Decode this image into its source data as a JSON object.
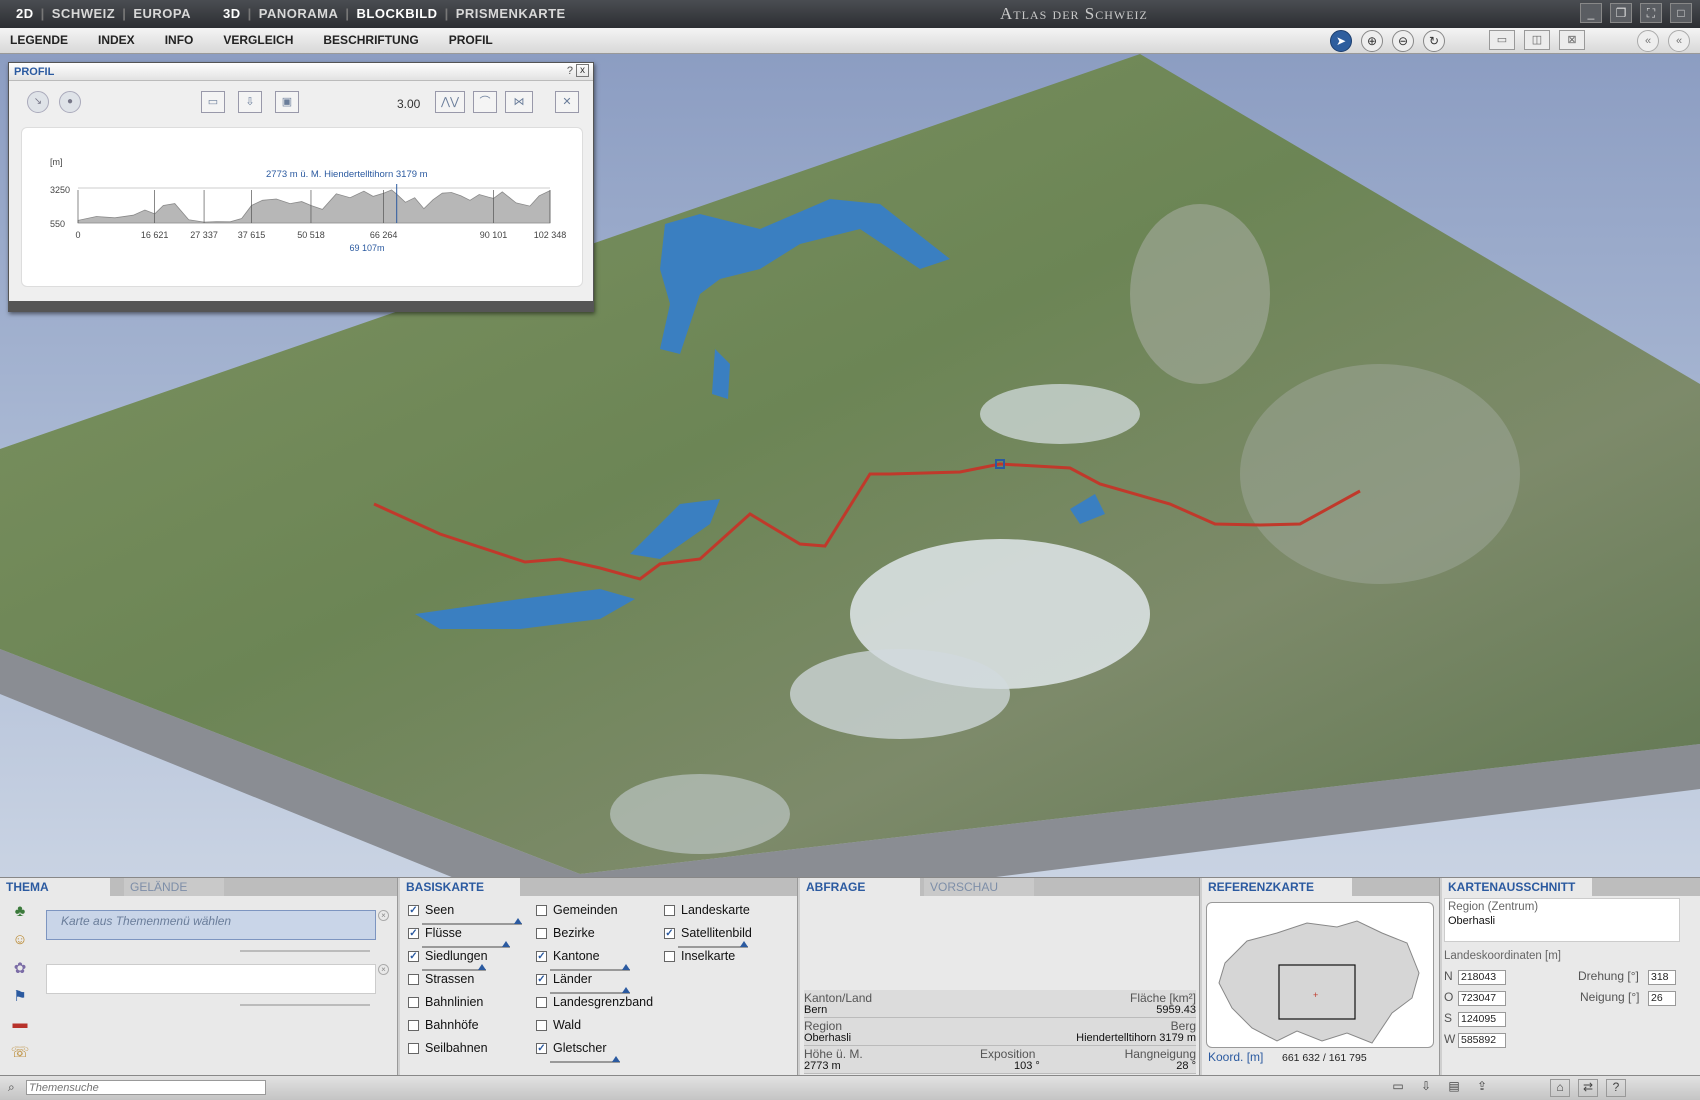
{
  "titlebar": {
    "modes": [
      "2D",
      "SCHWEIZ",
      "EUROPA",
      "3D",
      "PANORAMA",
      "BLOCKBILD",
      "PRISMENKARTE"
    ],
    "app_title": "Atlas der Schweiz",
    "window_buttons": [
      "minimize-icon",
      "restore-icon",
      "fullscreen-icon",
      "close-icon"
    ]
  },
  "menubar": {
    "items": [
      "LEGENDE",
      "INDEX",
      "INFO",
      "VERGLEICH",
      "BESCHRIFTUNG",
      "PROFIL"
    ],
    "tools": [
      "pointer-icon",
      "zoom-in-icon",
      "zoom-out-icon",
      "rotate-icon"
    ],
    "layout_tools": [
      "split-horizontal-icon",
      "split-vertical-icon",
      "diagonal-icon"
    ],
    "nav": [
      "collapse-icon",
      "back-icon"
    ]
  },
  "colors": {
    "accent": "#2b5aa0",
    "route": "#c0392b",
    "lake": "#3a7fc1",
    "terrain": "#6f8a52",
    "snow": "#e6eef2"
  },
  "profil": {
    "title": "PROFIL",
    "help": "?",
    "close": "x",
    "exaggeration": "3.00",
    "unit": "[m]",
    "y_top": "3250",
    "y_bottom": "550",
    "marker_label": "2773 m ü. M.  Hiendertelltihorn   3179 m",
    "cursor_distance": "69 107m",
    "x_ticks": [
      "0",
      "16 621",
      "27 337",
      "37 615",
      "50 518",
      "66 264",
      "90 101",
      "102 348"
    ],
    "chart_data": {
      "type": "area",
      "xlabel": "",
      "ylabel": "[m]",
      "ylim": [
        550,
        3250
      ],
      "xlim": [
        0,
        102348
      ],
      "x": [
        0,
        4000,
        8000,
        12000,
        14500,
        16621,
        18500,
        21000,
        24000,
        27337,
        30000,
        33000,
        35500,
        37615,
        40000,
        43000,
        46000,
        48500,
        50518,
        53000,
        56000,
        59000,
        62000,
        64000,
        66264,
        68000,
        69107,
        71000,
        73000,
        75000,
        77000,
        79000,
        81000,
        83000,
        85000,
        87000,
        89000,
        90101,
        92000,
        95000,
        98000,
        100000,
        102348
      ],
      "series": [
        {
          "name": "",
          "values": [
            750,
            1050,
            950,
            1150,
            1550,
            1250,
            1900,
            2050,
            800,
            620,
            650,
            640,
            900,
            1900,
            2300,
            2400,
            2050,
            2200,
            1900,
            1600,
            2800,
            2500,
            3000,
            2600,
            2850,
            3100,
            2773,
            2150,
            2500,
            1650,
            2350,
            2850,
            2900,
            2650,
            2300,
            2750,
            2550,
            2450,
            2950,
            2100,
            1850,
            2650,
            3050
          ]
        }
      ]
    },
    "toolbar": [
      "route-icon",
      "stop-icon",
      "folder-icon",
      "download-icon",
      "image-icon",
      "scale-icon",
      "curve-icon",
      "settings-icon",
      "clear-icon"
    ]
  },
  "thema": {
    "tab_active": "THEMA",
    "tab_inactive": "GELÄNDE",
    "placeholder": "Karte aus Themenmenü wählen",
    "second_field": "",
    "icons": [
      "forest-icon",
      "people-icon",
      "economy-icon",
      "flag-icon",
      "train-icon",
      "phone-icon"
    ],
    "search_placeholder": "Themensuche"
  },
  "basiskarte": {
    "title": "BASISKARTE",
    "col1": [
      {
        "label": "Seen",
        "checked": true
      },
      {
        "label": "Flüsse",
        "checked": true
      },
      {
        "label": "Siedlungen",
        "checked": true
      },
      {
        "label": "Strassen",
        "checked": false
      },
      {
        "label": "Bahnlinien",
        "checked": false
      },
      {
        "label": "Bahnhöfe",
        "checked": false
      },
      {
        "label": "Seilbahnen",
        "checked": false
      }
    ],
    "col2": [
      {
        "label": "Gemeinden",
        "checked": false
      },
      {
        "label": "Bezirke",
        "checked": false
      },
      {
        "label": "Kantone",
        "checked": true
      },
      {
        "label": "Länder",
        "checked": true
      },
      {
        "label": "Landesgrenzband",
        "checked": false
      },
      {
        "label": "Wald",
        "checked": false
      },
      {
        "label": "Gletscher",
        "checked": true
      }
    ],
    "col3": [
      {
        "label": "Landeskarte",
        "checked": false
      },
      {
        "label": "Satellitenbild",
        "checked": true
      },
      {
        "label": "Inselkarte",
        "checked": false
      }
    ]
  },
  "abfrage": {
    "tab_active": "ABFRAGE",
    "tab_inactive": "VORSCHAU",
    "kanton_label": "Kanton/Land",
    "kanton_value": "Bern",
    "flaeche_label": "Fläche [km²]",
    "flaeche_value": "5959.43",
    "region_label": "Region",
    "region_value": "Oberhasli",
    "berg_label": "Berg",
    "berg_value": "Hiendertelltihorn   3179 m",
    "hoehe_label": "Höhe ü. M.",
    "hoehe_value": "2773 m",
    "exposition_label": "Exposition",
    "exposition_value": "103 °",
    "hang_label": "Hangneigung",
    "hang_value": "28 °"
  },
  "referenzkarte": {
    "title": "REFERENZKARTE",
    "coord_label": "Koord. [m]",
    "coord_value": "661 632 / 161 795"
  },
  "kartenausschnitt": {
    "title": "KARTENAUSSCHNITT",
    "region_label": "Region (Zentrum)",
    "region_value": "Oberhasli",
    "coords_label": "Landeskoordinaten [m]",
    "n_label": "N",
    "n_value": "218043",
    "o_label": "O",
    "o_value": "723047",
    "s_label": "S",
    "s_value": "124095",
    "w_label": "W",
    "w_value": "585892",
    "drehung_label": "Drehung [°]",
    "drehung_value": "318",
    "neigung_label": "Neigung [°]",
    "neigung_value": "26"
  },
  "statusbar": {
    "icons": [
      "open-icon",
      "save-icon",
      "print-icon",
      "export-icon",
      "home-icon",
      "link-icon",
      "help-icon"
    ]
  }
}
